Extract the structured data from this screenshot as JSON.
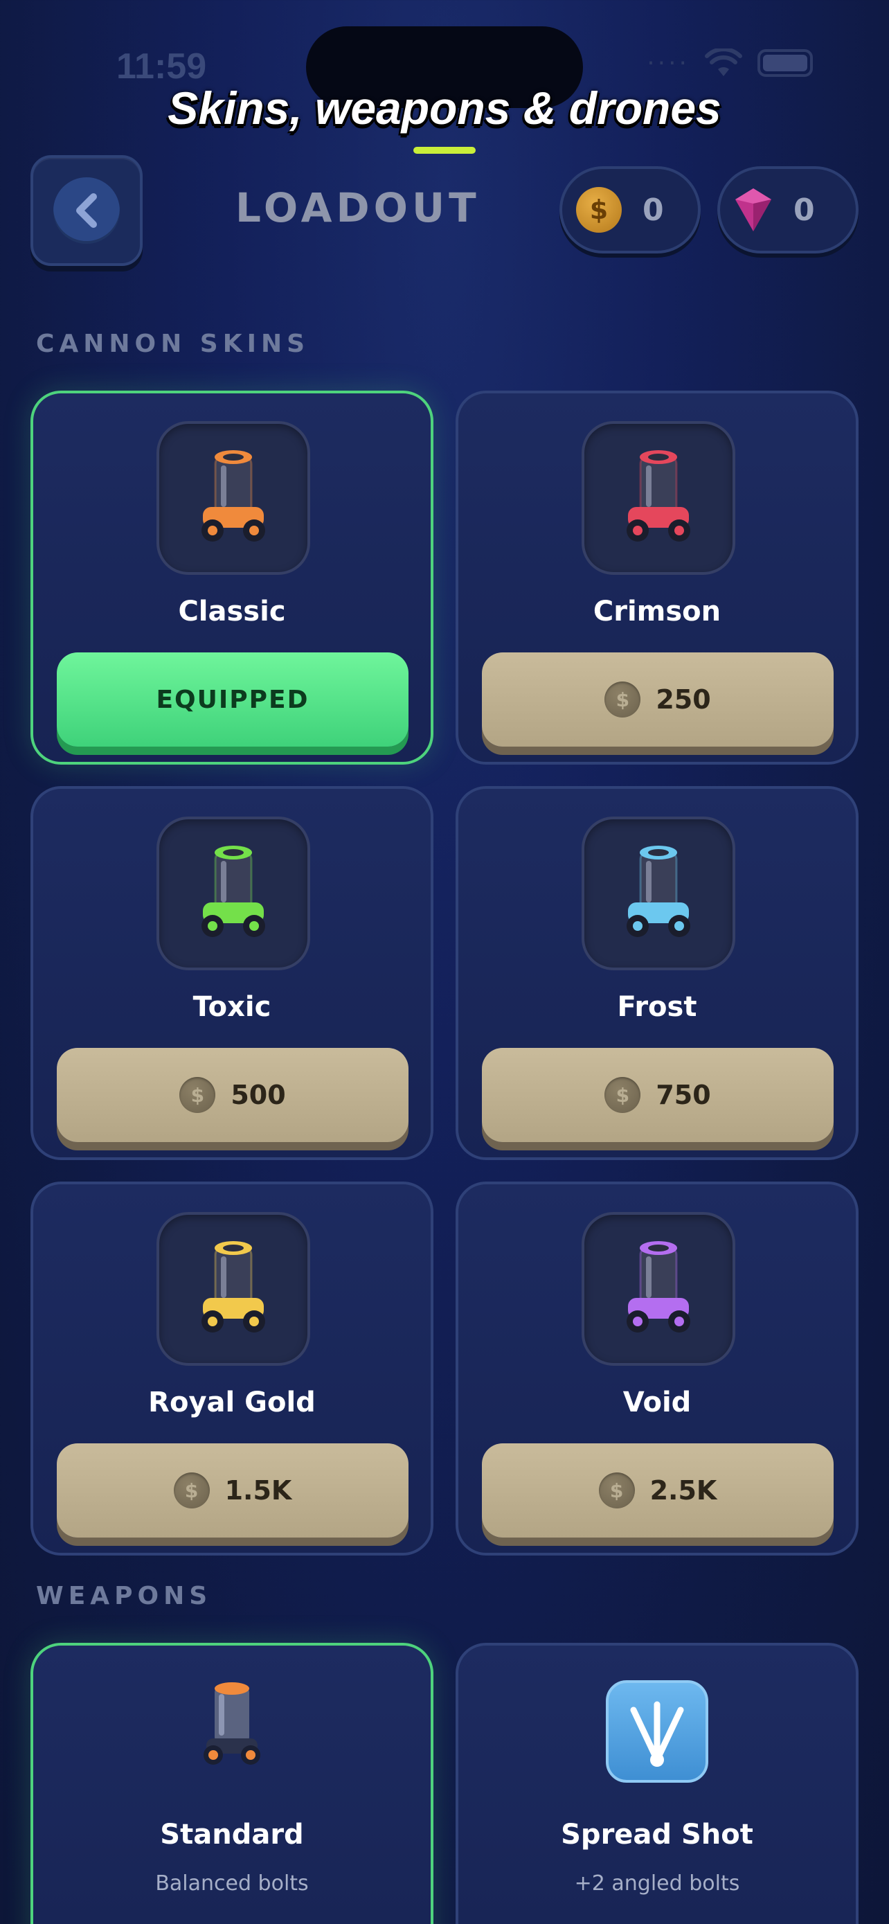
{
  "status_bar": {
    "time": "11:59",
    "signal_dots": "····"
  },
  "headline": "Skins, weapons & drones",
  "header": {
    "title": "LOADOUT",
    "coins": "0",
    "gems": "0"
  },
  "sections": {
    "skins_label": "CANNON SKINS",
    "weapons_label": "WEAPONS"
  },
  "currency_symbol": "$",
  "skins": [
    {
      "name": "Classic",
      "action": "EQUIPPED",
      "equipped": true,
      "color": "#f08a3c"
    },
    {
      "name": "Crimson",
      "action": "250",
      "equipped": false,
      "color": "#e5475c"
    },
    {
      "name": "Toxic",
      "action": "500",
      "equipped": false,
      "color": "#74e04a"
    },
    {
      "name": "Frost",
      "action": "750",
      "equipped": false,
      "color": "#6cc8ef"
    },
    {
      "name": "Royal Gold",
      "action": "1.5K",
      "equipped": false,
      "color": "#f2c94c"
    },
    {
      "name": "Void",
      "action": "2.5K",
      "equipped": false,
      "color": "#b46ef0"
    }
  ],
  "weapons": [
    {
      "name": "Standard",
      "desc": "Balanced bolts",
      "equipped": true
    },
    {
      "name": "Spread Shot",
      "desc": "+2 angled bolts",
      "equipped": false
    }
  ],
  "colors": {
    "equipped_border": "#4ed37d",
    "accent": "#c9ee3a"
  }
}
